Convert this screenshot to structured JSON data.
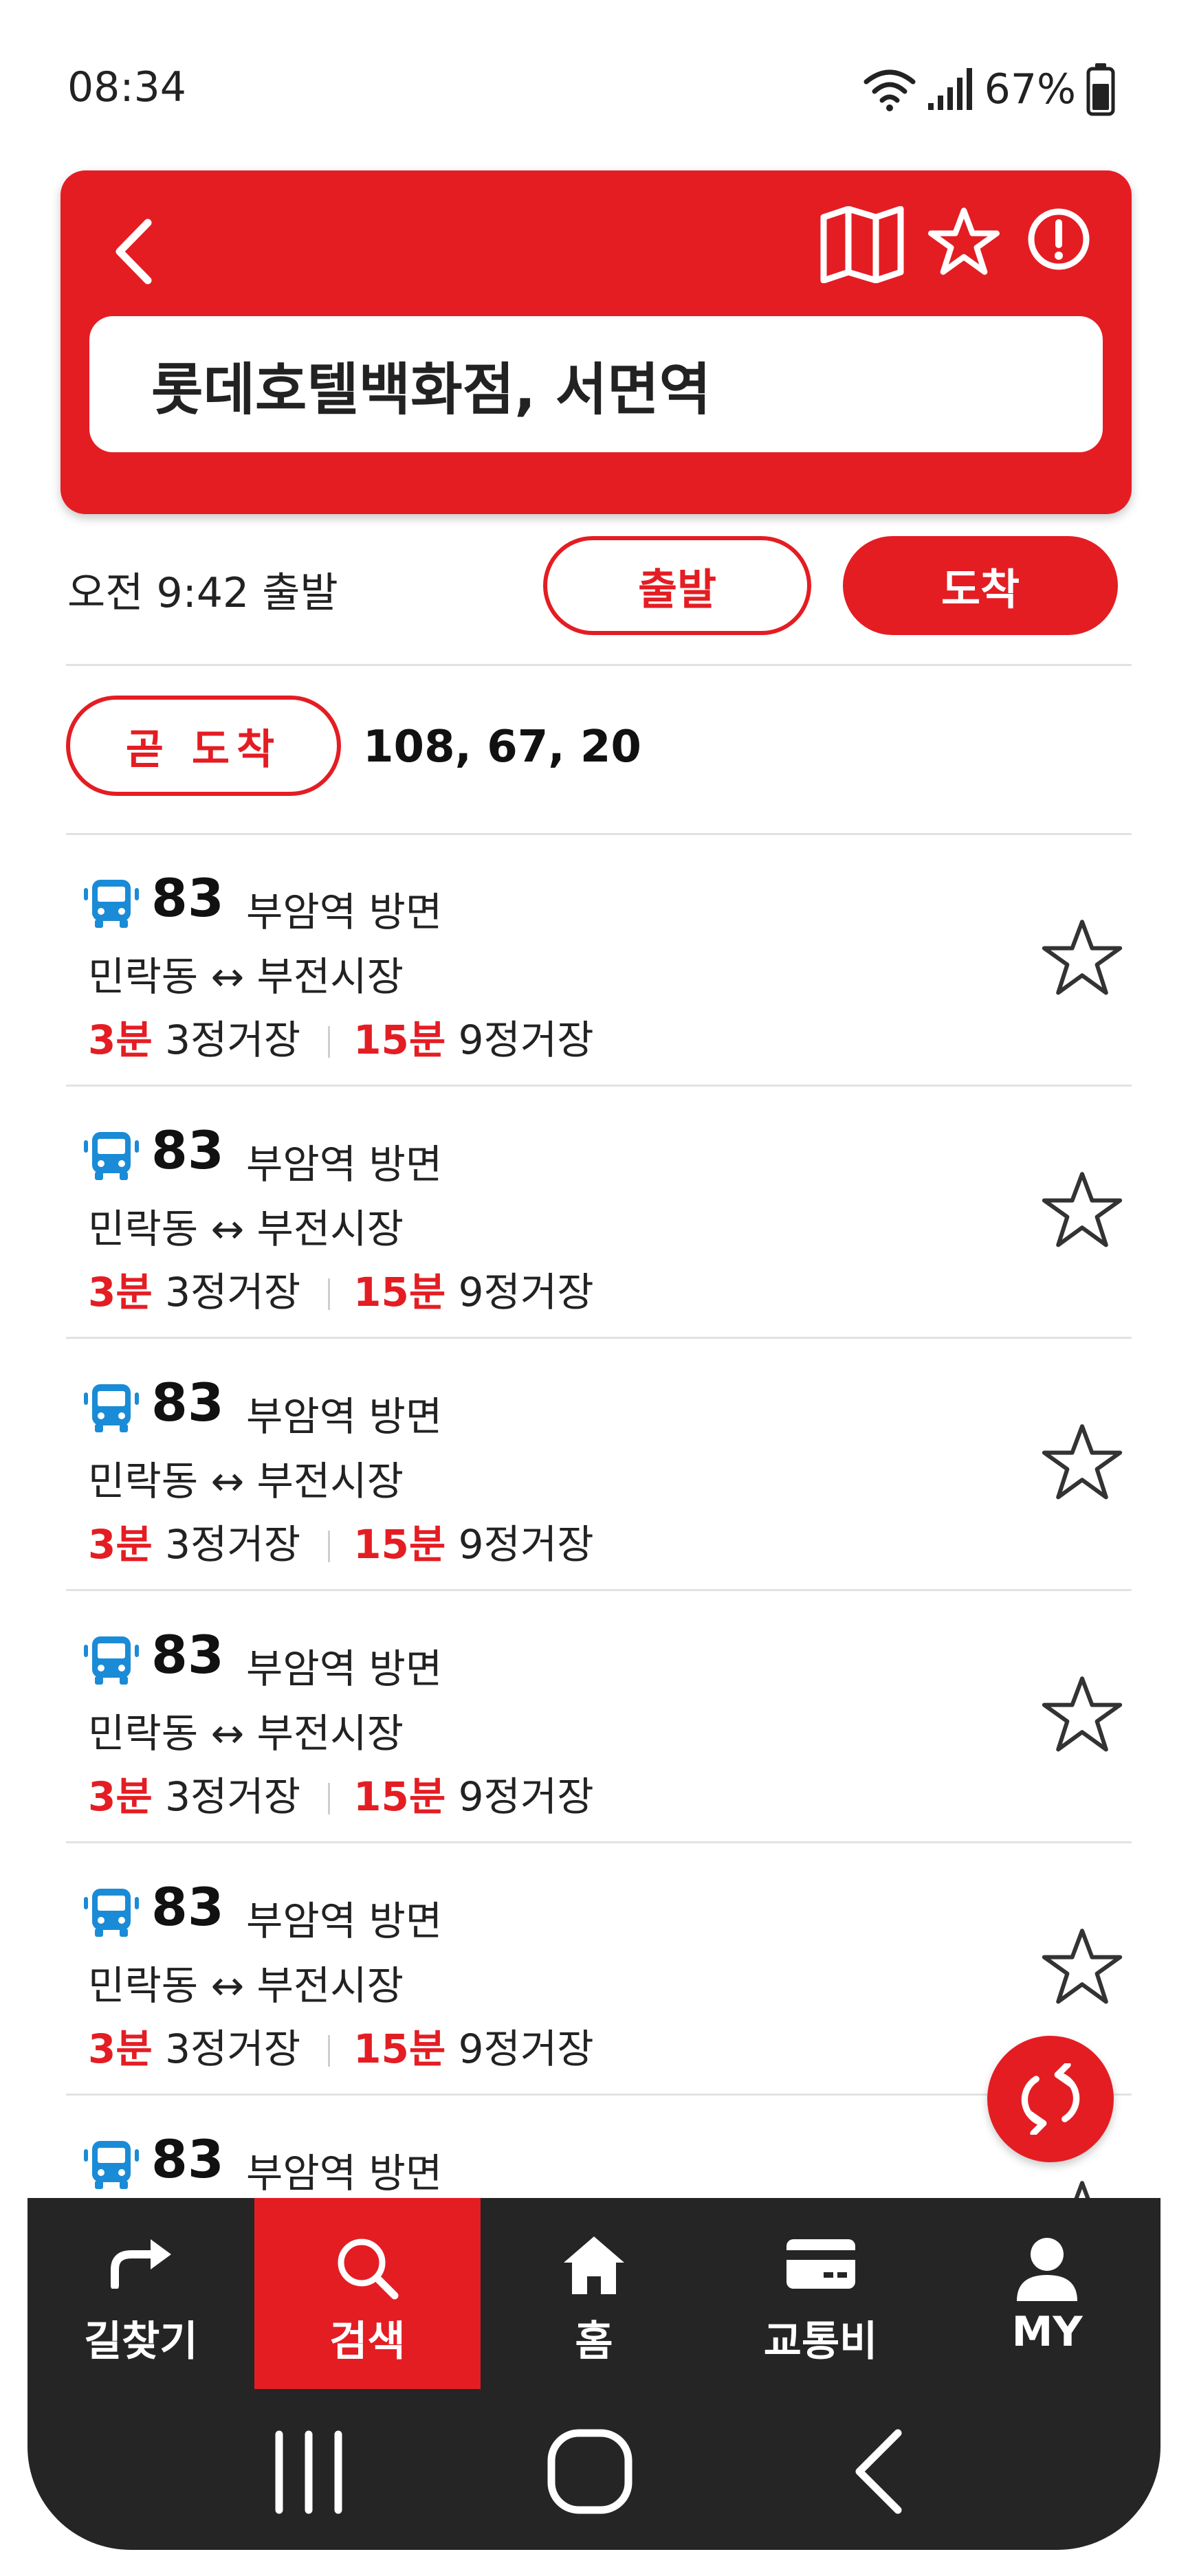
{
  "status_bar": {
    "time": "08:34",
    "battery": "67%"
  },
  "header": {
    "search_text": "롯데호텔백화점, 서면역"
  },
  "departure": {
    "time_text": "오전 9:42 출발",
    "depart_label": "출발",
    "arrive_label": "도착"
  },
  "soon": {
    "badge_label": "곧 도착",
    "routes": "108, 67, 20"
  },
  "routes": [
    {
      "number": "83",
      "direction": "부암역 방면",
      "path": "민락동 ↔ 부전시장",
      "first_min": "3분",
      "first_stops": "3정거장",
      "second_min": "15분",
      "second_stops": "9정거장"
    },
    {
      "number": "83",
      "direction": "부암역 방면",
      "path": "민락동 ↔ 부전시장",
      "first_min": "3분",
      "first_stops": "3정거장",
      "second_min": "15분",
      "second_stops": "9정거장"
    },
    {
      "number": "83",
      "direction": "부암역 방면",
      "path": "민락동 ↔ 부전시장",
      "first_min": "3분",
      "first_stops": "3정거장",
      "second_min": "15분",
      "second_stops": "9정거장"
    },
    {
      "number": "83",
      "direction": "부암역 방면",
      "path": "민락동 ↔ 부전시장",
      "first_min": "3분",
      "first_stops": "3정거장",
      "second_min": "15분",
      "second_stops": "9정거장"
    },
    {
      "number": "83",
      "direction": "부암역 방면",
      "path": "민락동 ↔ 부전시장",
      "first_min": "3분",
      "first_stops": "3정거장",
      "second_min": "15분",
      "second_stops": "9정거장"
    },
    {
      "number": "83",
      "direction": "부암역 방면",
      "path": "",
      "first_min": "",
      "first_stops": "",
      "second_min": "",
      "second_stops": ""
    }
  ],
  "tabs": [
    {
      "label": "길찾기",
      "icon": "directions-arrow-icon"
    },
    {
      "label": "검색",
      "icon": "search-icon"
    },
    {
      "label": "홈",
      "icon": "home-icon"
    },
    {
      "label": "교통비",
      "icon": "card-icon"
    },
    {
      "label": "MY",
      "icon": "person-icon"
    }
  ],
  "colors": {
    "accent": "#E41D23",
    "bus_icon": "#1A8BD6",
    "nav_bg": "#252525"
  }
}
